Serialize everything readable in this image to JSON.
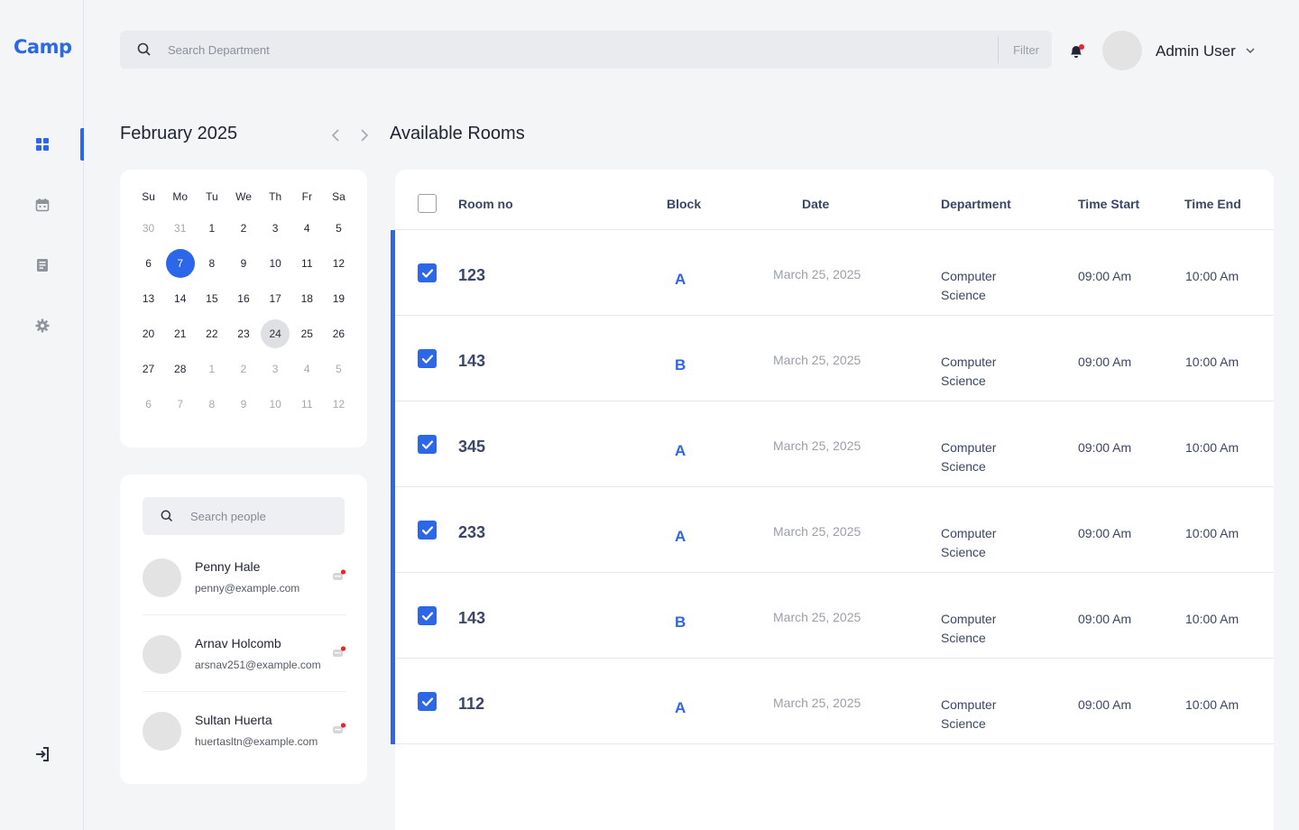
{
  "app": {
    "logo": "Camp"
  },
  "sidebar": {
    "items": [
      {
        "icon": "dashboard-icon",
        "active": true
      },
      {
        "icon": "calendar-icon",
        "active": false
      },
      {
        "icon": "document-icon",
        "active": false
      },
      {
        "icon": "gear-icon",
        "active": false
      }
    ],
    "logout_icon": "logout-icon"
  },
  "header": {
    "search_placeholder": "Search Department",
    "filter_label": "Filter",
    "user_name": "Admin User"
  },
  "calendar": {
    "month": "February 2025",
    "weekdays": [
      "Su",
      "Mo",
      "Tu",
      "We",
      "Th",
      "Fr",
      "Sa"
    ],
    "weeks": [
      [
        {
          "d": "30",
          "m": true
        },
        {
          "d": "31",
          "m": true
        },
        {
          "d": "1"
        },
        {
          "d": "2"
        },
        {
          "d": "3"
        },
        {
          "d": "4"
        },
        {
          "d": "5"
        }
      ],
      [
        {
          "d": "6"
        },
        {
          "d": "7",
          "sel": true
        },
        {
          "d": "8"
        },
        {
          "d": "9"
        },
        {
          "d": "10"
        },
        {
          "d": "11"
        },
        {
          "d": "12"
        }
      ],
      [
        {
          "d": "13"
        },
        {
          "d": "14"
        },
        {
          "d": "15"
        },
        {
          "d": "16"
        },
        {
          "d": "17"
        },
        {
          "d": "18"
        },
        {
          "d": "19"
        }
      ],
      [
        {
          "d": "20"
        },
        {
          "d": "21"
        },
        {
          "d": "22"
        },
        {
          "d": "23"
        },
        {
          "d": "24",
          "today": true
        },
        {
          "d": "25"
        },
        {
          "d": "26"
        }
      ],
      [
        {
          "d": "27"
        },
        {
          "d": "28"
        },
        {
          "d": "1",
          "m": true
        },
        {
          "d": "2",
          "m": true
        },
        {
          "d": "3",
          "m": true
        },
        {
          "d": "4",
          "m": true
        },
        {
          "d": "5",
          "m": true
        }
      ],
      [
        {
          "d": "6",
          "m": true
        },
        {
          "d": "7",
          "m": true
        },
        {
          "d": "8",
          "m": true
        },
        {
          "d": "9",
          "m": true
        },
        {
          "d": "10",
          "m": true
        },
        {
          "d": "11",
          "m": true
        },
        {
          "d": "12",
          "m": true
        }
      ]
    ]
  },
  "people": {
    "search_placeholder": "Search people",
    "list": [
      {
        "name": "Penny Hale",
        "email": "penny@example.com"
      },
      {
        "name": "Arnav Holcomb",
        "email": "arsnav251@example.com"
      },
      {
        "name": "Sultan Huerta",
        "email": "huertasltn@example.com"
      }
    ]
  },
  "rooms": {
    "title": "Available Rooms",
    "columns": {
      "room_no": "Room no",
      "block": "Block",
      "date": "Date",
      "department": "Department",
      "time_start": "Time Start",
      "time_end": "Time End"
    },
    "header_checked": false,
    "rows": [
      {
        "room": "123",
        "block": "A",
        "date": "March 25, 2025",
        "dept": "Computer Science",
        "start": "09:00 Am",
        "end": "10:00 Am",
        "checked": true
      },
      {
        "room": "143",
        "block": "B",
        "date": "March 25, 2025",
        "dept": "Computer Science",
        "start": "09:00 Am",
        "end": "10:00 Am",
        "checked": true
      },
      {
        "room": "345",
        "block": "A",
        "date": "March 25, 2025",
        "dept": "Computer Science",
        "start": "09:00 Am",
        "end": "10:00 Am",
        "checked": true
      },
      {
        "room": "233",
        "block": "A",
        "date": "March 25, 2025",
        "dept": "Computer Science",
        "start": "09:00 Am",
        "end": "10:00 Am",
        "checked": true
      },
      {
        "room": "143",
        "block": "B",
        "date": "March 25, 2025",
        "dept": "Computer Science",
        "start": "09:00 Am",
        "end": "10:00 Am",
        "checked": true
      },
      {
        "room": "112",
        "block": "A",
        "date": "March 25, 2025",
        "dept": "Computer Science",
        "start": "09:00 Am",
        "end": "10:00 Am",
        "checked": true
      }
    ]
  },
  "colors": {
    "accent": "#2b67e8",
    "notify": "#e8242d",
    "text": "#3a4663"
  }
}
